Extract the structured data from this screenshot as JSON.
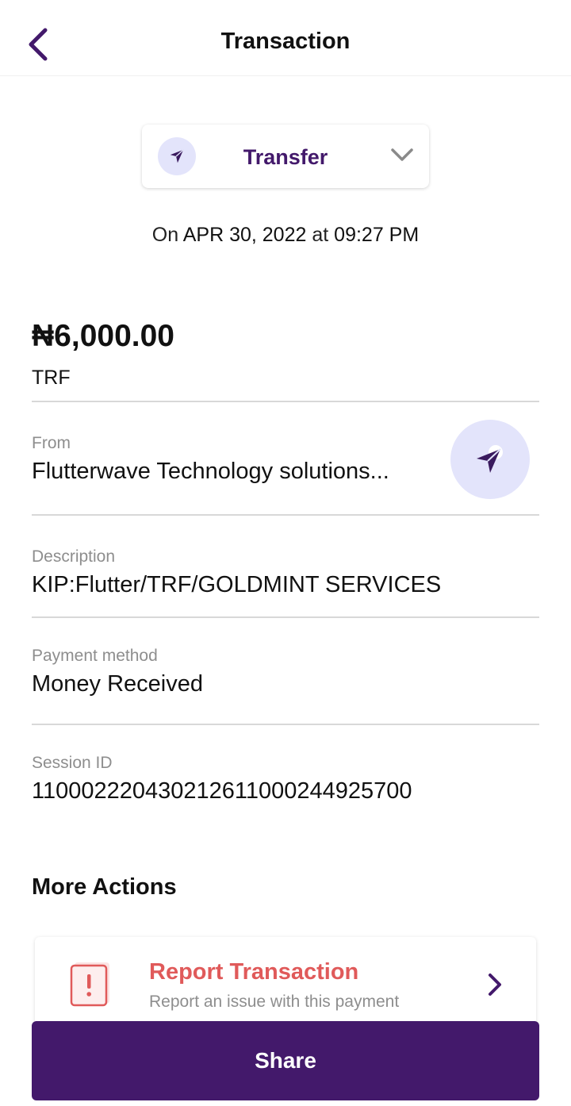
{
  "header": {
    "title": "Transaction",
    "back_icon": "chevron-left-icon"
  },
  "transaction_type": {
    "label": "Transfer",
    "icon": "send-icon",
    "dropdown_icon": "chevron-down-icon"
  },
  "date_line": {
    "prefix": "On",
    "date": "APR 30, 2022",
    "connector": "at",
    "time": "09:27 PM"
  },
  "amount": {
    "value": "₦6,000.00",
    "code": "TRF"
  },
  "fields": {
    "from": {
      "label": "From",
      "value": "Flutterwave Technology solutions...",
      "icon": "send-icon"
    },
    "description": {
      "label": "Description",
      "value": "KIP:Flutter/TRF/GOLDMINT SERVICES"
    },
    "payment_method": {
      "label": "Payment method",
      "value": "Money Received"
    },
    "session_id": {
      "label": "Session ID",
      "value": "110002220430212611000244925700"
    }
  },
  "more_actions": {
    "title": "More Actions",
    "report": {
      "title": "Report Transaction",
      "subtitle": "Report an issue with this payment",
      "icon": "alert-document-icon",
      "chevron": "chevron-right-icon"
    }
  },
  "share_button": {
    "label": "Share"
  },
  "colors": {
    "brand": "#43196b",
    "icon_bg": "#e3e4fb",
    "danger": "#e05a5a",
    "muted": "#8e8e8e"
  }
}
